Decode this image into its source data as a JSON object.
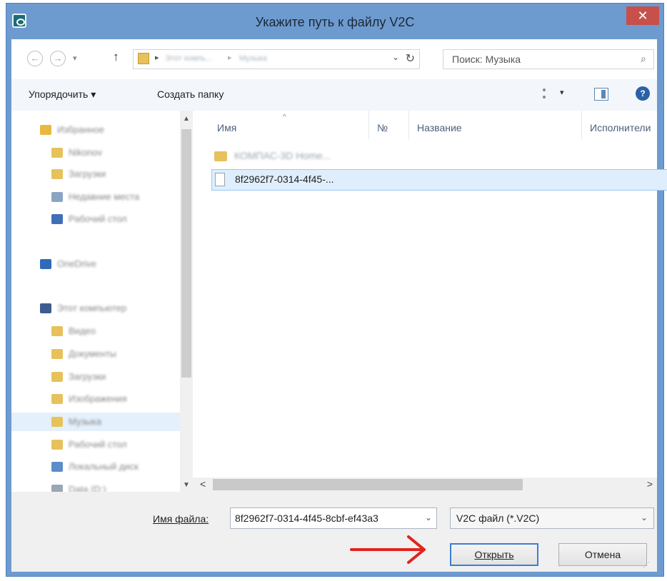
{
  "window": {
    "title": "Укажите путь к файлу V2C",
    "close_glyph": "✕"
  },
  "nav": {
    "back_glyph": "←",
    "forward_glyph": "→",
    "history_glyph": "▾",
    "up_glyph": "↑",
    "breadcrumb": [
      "Этот компь...",
      "Музыка"
    ],
    "dropdown_glyph": "⌄",
    "refresh_glyph": "↻",
    "search_placeholder": "Поиск: Музыка",
    "search_icon_glyph": "⌕"
  },
  "toolbar": {
    "organize_label": "Упорядочить ▾",
    "new_folder_label": "Создать папку",
    "view_dd_glyph": "▾",
    "help_glyph": "?"
  },
  "sidebar": {
    "items": [
      {
        "label": "Избранное",
        "color": "#e9b83f",
        "indent": false
      },
      {
        "label": "Nikonov",
        "color": "#e7c25b",
        "indent": true
      },
      {
        "label": "Загрузки",
        "color": "#e7c25b",
        "indent": true
      },
      {
        "label": "Недавние места",
        "color": "#8aa5c4",
        "indent": true
      },
      {
        "label": "Рабочий стол",
        "color": "#3f6fb8",
        "indent": true
      },
      {
        "label": "OneDrive",
        "color": "#2f6bb8",
        "indent": false
      },
      {
        "label": "Этот компьютер",
        "color": "#3c5d8f",
        "indent": false
      },
      {
        "label": "Видео",
        "color": "#e7c25b",
        "indent": true
      },
      {
        "label": "Документы",
        "color": "#e7c25b",
        "indent": true
      },
      {
        "label": "Загрузки",
        "color": "#e7c25b",
        "indent": true
      },
      {
        "label": "Изображения",
        "color": "#e7c25b",
        "indent": true
      },
      {
        "label": "Музыка",
        "color": "#e7c25b",
        "indent": true
      },
      {
        "label": "Рабочий стол",
        "color": "#e7c25b",
        "indent": true
      },
      {
        "label": "Локальный диск",
        "color": "#5c8cc9",
        "indent": true
      },
      {
        "label": "Data (D:)",
        "color": "#9aa7b4",
        "indent": true
      }
    ],
    "selected_index": 11,
    "scroll_up_glyph": "▲",
    "scroll_down_glyph": "▼"
  },
  "files": {
    "columns": [
      "Имя",
      "№",
      "Название",
      "Исполнители"
    ],
    "sort_glyph": "^",
    "rows": [
      {
        "name": "КОМПАС-3D Home...",
        "kind": "folder",
        "blurred": true
      },
      {
        "name": "8f2962f7-0314-4f45-...",
        "kind": "file",
        "blurred": false
      }
    ],
    "selected_index": 1
  },
  "hscroll": {
    "left_glyph": "<",
    "right_glyph": ">"
  },
  "bottom": {
    "filename_label": "Имя файла:",
    "filename_value": "8f2962f7-0314-4f45-8cbf-ef43a3",
    "filename_dd_glyph": "⌄",
    "filetype_value": "V2C файл (*.V2C)",
    "filetype_dd_glyph": "⌄",
    "open_label": "Открыть",
    "cancel_label": "Отмена"
  },
  "colors": {
    "title_bar": "#6d9bd0",
    "close_button": "#c7504a",
    "selection": "#dfeefc",
    "annotation_arrow": "#e2221d"
  }
}
